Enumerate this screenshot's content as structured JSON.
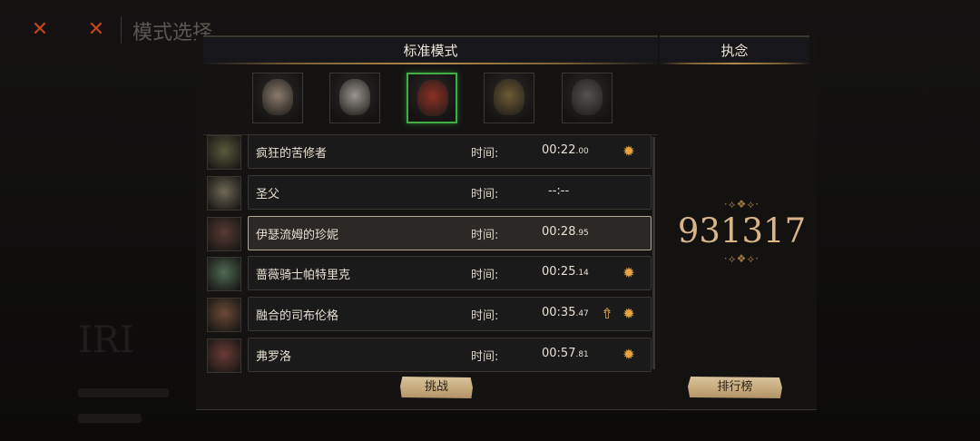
{
  "background": {
    "title": "模式选择"
  },
  "modal": {
    "mode_title": "标准模式",
    "obsession_title": "执念",
    "score": "931317",
    "score_ornament_top": "·⟡❖⟡·",
    "score_ornament_bottom": "·⟡❖⟡·",
    "challenge_button": "挑战",
    "leaderboard_button": "排行榜"
  },
  "characters": [
    {
      "name": "character-1",
      "selected": false,
      "color": "#8a7b6c"
    },
    {
      "name": "character-2",
      "selected": false,
      "color": "#9a9590"
    },
    {
      "name": "character-3",
      "selected": true,
      "color": "#8c2f24"
    },
    {
      "name": "character-4",
      "selected": false,
      "color": "#6d5a35"
    },
    {
      "name": "character-5",
      "selected": false,
      "color": "#55524f"
    }
  ],
  "bosses": [
    {
      "name": "疯狂的苦修者",
      "time_label": "时间:",
      "time_main": "00:22",
      "time_ms": ".00",
      "icons": [
        "rank-icon"
      ],
      "highlight": false,
      "thumb_color": "#5a5a3c"
    },
    {
      "name": "圣父",
      "time_label": "时间:",
      "time_main": "--:--",
      "time_ms": "",
      "icons": [],
      "highlight": false,
      "thumb_color": "#6f6856"
    },
    {
      "name": "伊瑟流姆的珍妮",
      "time_label": "时间:",
      "time_main": "00:28",
      "time_ms": ".95",
      "icons": [],
      "highlight": true,
      "thumb_color": "#5a3a33"
    },
    {
      "name": "蔷薇骑士帕特里克",
      "time_label": "时间:",
      "time_main": "00:25",
      "time_ms": ".14",
      "icons": [
        "rank-icon"
      ],
      "highlight": false,
      "thumb_color": "#4f6a52"
    },
    {
      "name": "融合的司布伦格",
      "time_label": "时间:",
      "time_main": "00:35",
      "time_ms": ".47",
      "icons": [
        "upgrade-arrow-icon",
        "rank-icon"
      ],
      "highlight": false,
      "thumb_color": "#6b4a36"
    },
    {
      "name": "弗罗洛",
      "time_label": "时间:",
      "time_main": "00:57",
      "time_ms": ".81",
      "icons": [
        "rank-icon"
      ],
      "highlight": false,
      "thumb_color": "#6b3b35"
    }
  ],
  "colors": {
    "accent_gold": "#d8b487",
    "selected_border": "#3faf45",
    "close_orange": "#c0461b"
  }
}
